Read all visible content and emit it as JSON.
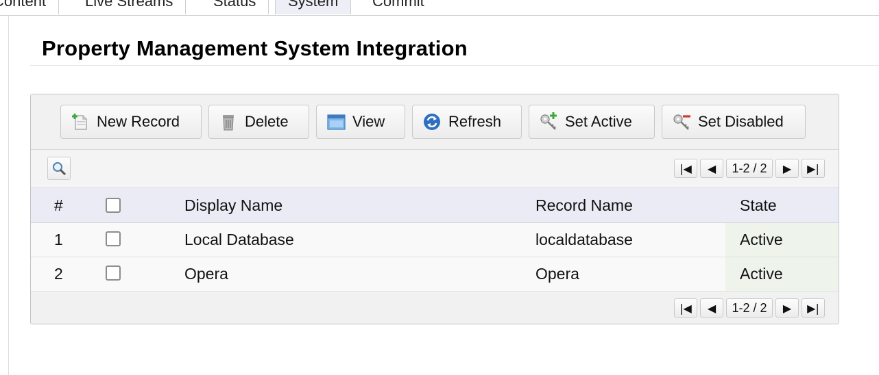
{
  "nav": {
    "tabs": [
      {
        "label": "Content"
      },
      {
        "label": "Live Streams"
      },
      {
        "label": "Status"
      },
      {
        "label": "System"
      },
      {
        "label": "Commit"
      }
    ]
  },
  "page": {
    "title": "Property Management System Integration"
  },
  "toolbar": {
    "new_record": "New Record",
    "delete": "Delete",
    "view": "View",
    "refresh": "Refresh",
    "set_active": "Set Active",
    "set_disabled": "Set Disabled"
  },
  "pager": {
    "first": "|◀",
    "prev": "◀",
    "info": "1-2 / 2",
    "next": "▶",
    "last": "▶|"
  },
  "table": {
    "columns": {
      "index": "#",
      "display_name": "Display Name",
      "record_name": "Record Name",
      "state": "State"
    },
    "rows": [
      {
        "index": "1",
        "display_name": "Local Database",
        "record_name": "localdatabase",
        "state": "Active"
      },
      {
        "index": "2",
        "display_name": "Opera",
        "record_name": "Opera",
        "state": "Active"
      }
    ]
  },
  "icons": {
    "new_record": "new-document-icon",
    "delete": "trash-icon",
    "view": "window-icon",
    "refresh": "refresh-icon",
    "set_active": "key-plus-icon",
    "set_disabled": "key-minus-icon",
    "search": "magnifier-icon"
  },
  "colors": {
    "header_bg": "#ebebf6",
    "active_state_bg": "#eef4ec",
    "active_tab_bg": "#eeeef6"
  }
}
